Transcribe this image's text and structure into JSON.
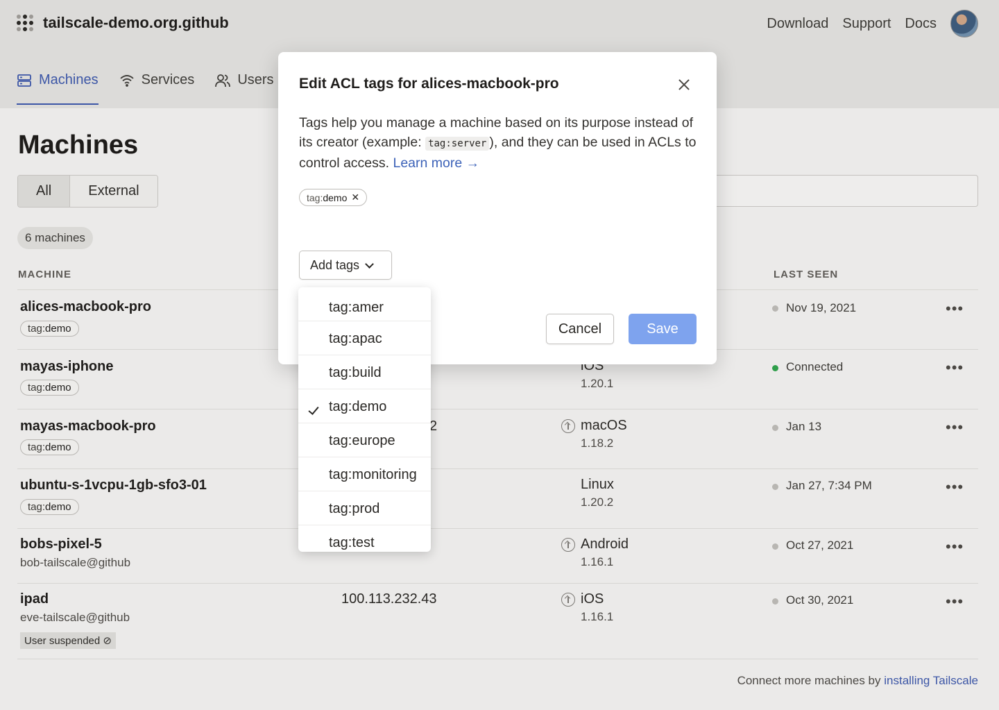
{
  "app": {
    "org_name": "tailscale-demo.org.github",
    "top_links": [
      "Download",
      "Support",
      "Docs"
    ]
  },
  "nav": {
    "tabs": [
      {
        "label": "Machines",
        "icon": "machines-icon",
        "active": true
      },
      {
        "label": "Services",
        "icon": "wifi-icon",
        "active": false
      },
      {
        "label": "Users",
        "icon": "users-icon",
        "active": false
      }
    ]
  },
  "page": {
    "title": "Machines",
    "filter_all": "All",
    "filter_external": "External",
    "machine_count": "6 machines",
    "col_machine": "MACHINE",
    "col_last_seen": "LAST SEEN",
    "footer_text": "Connect more machines by",
    "footer_link": "installing Tailscale"
  },
  "machines": [
    {
      "name": "alices-macbook-pro",
      "tag_prefix": "tag:",
      "tag_value": "demo",
      "ip": "",
      "os": "",
      "os_version": "",
      "update": false,
      "last_seen": "Nov 19, 2021",
      "status": "offline"
    },
    {
      "name": "mayas-iphone",
      "tag_prefix": "tag:",
      "tag_value": "demo",
      "ip": "",
      "os": "iOS",
      "os_version": "1.20.1",
      "update": false,
      "last_seen": "Connected",
      "status": "online"
    },
    {
      "name": "mayas-macbook-pro",
      "tag_prefix": "tag:",
      "tag_value": "demo",
      "ip": "2",
      "os": "macOS",
      "os_version": "1.18.2",
      "update": true,
      "last_seen": "Jan 13",
      "status": "offline"
    },
    {
      "name": "ubuntu-s-1vcpu-1gb-sfo3-01",
      "tag_prefix": "tag:",
      "tag_value": "demo",
      "ip": "",
      "os": "Linux",
      "os_version": "1.20.2",
      "update": false,
      "last_seen": "Jan 27, 7:34 PM",
      "status": "offline"
    },
    {
      "name": "bobs-pixel-5",
      "owner": "bob-tailscale@github",
      "ip": "",
      "os": "Android",
      "os_version": "1.16.1",
      "update": true,
      "last_seen": "Oct 27, 2021",
      "status": "offline"
    },
    {
      "name": "ipad",
      "owner": "eve-tailscale@github",
      "badge": "User suspended",
      "ip": "100.113.232.43",
      "os": "iOS",
      "os_version": "1.16.1",
      "update": true,
      "last_seen": "Oct 30, 2021",
      "status": "offline"
    }
  ],
  "modal": {
    "title": "Edit ACL tags for alices-macbook-pro",
    "desc_part1": "Tags help you manage a machine based on its purpose instead of its creator (example: ",
    "desc_code": "tag:server",
    "desc_part2": "), and they can be used in ACLs to control access. ",
    "learn_more": "Learn more →",
    "current_tag_prefix": "tag:",
    "current_tag_value": "demo",
    "add_tags_label": "Add tags",
    "cancel_label": "Cancel",
    "save_label": "Save"
  },
  "tag_options": [
    {
      "label": "tag:amer",
      "checked": false
    },
    {
      "label": "tag:apac",
      "checked": false
    },
    {
      "label": "tag:build",
      "checked": false
    },
    {
      "label": "tag:demo",
      "checked": true
    },
    {
      "label": "tag:europe",
      "checked": false
    },
    {
      "label": "tag:monitoring",
      "checked": false
    },
    {
      "label": "tag:prod",
      "checked": false
    },
    {
      "label": "tag:test",
      "checked": false
    }
  ],
  "colors": {
    "accent": "#3c56a6",
    "save_button": "#7ea3ee",
    "online_dot": "#2f9e4a",
    "offline_dot": "#b8b6b2"
  }
}
